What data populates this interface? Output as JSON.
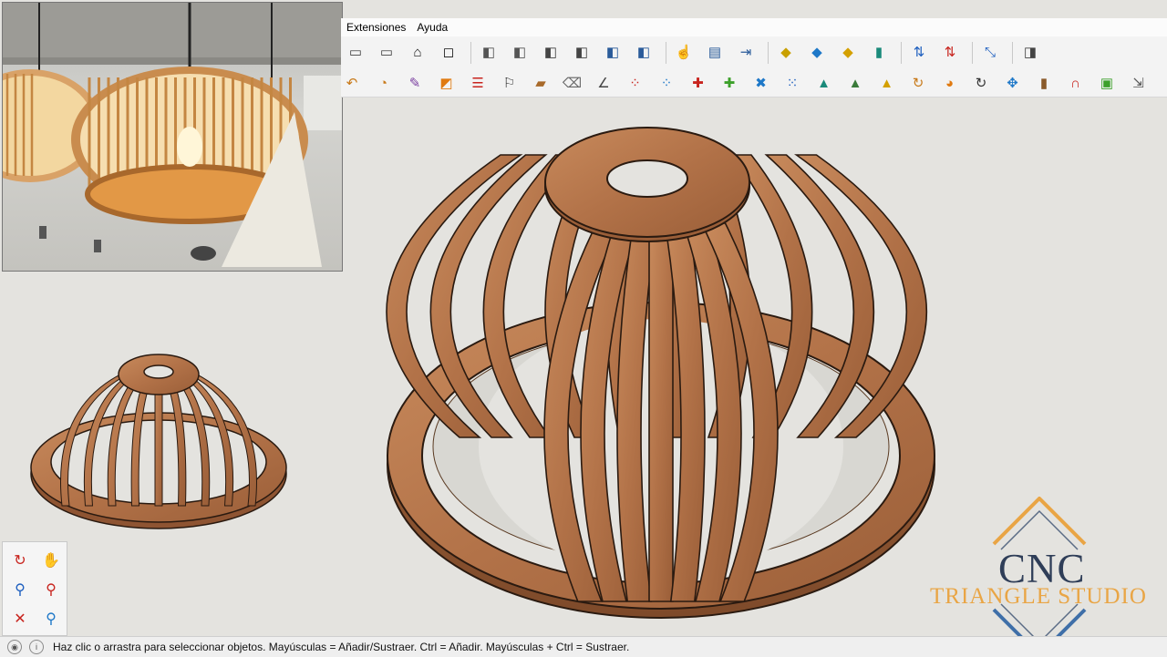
{
  "menu": {
    "extensions": "Extensiones",
    "help": "Ayuda"
  },
  "status": {
    "message": "Haz clic o arrastra para seleccionar objetos. Mayúsculas = Añadir/Sustraer. Ctrl = Añadir. Mayúsculas + Ctrl = Sustraer."
  },
  "logo": {
    "title": "CNC",
    "subtitle": "TRIANGLE STUDIO"
  },
  "toolbar_row1": [
    {
      "icon": "warehouse-icon",
      "glyph": "▭",
      "color": "#444"
    },
    {
      "icon": "warehouse-open-icon",
      "glyph": "▭",
      "color": "#444"
    },
    {
      "icon": "home-icon",
      "glyph": "⌂",
      "color": "#111"
    },
    {
      "icon": "square-icon",
      "glyph": "◻",
      "color": "#111"
    },
    {
      "icon": "view-iso-icon",
      "glyph": "◧",
      "color": "#555"
    },
    {
      "icon": "view-top-icon",
      "glyph": "◧",
      "color": "#555"
    },
    {
      "icon": "view-front-icon",
      "glyph": "◧",
      "color": "#444"
    },
    {
      "icon": "view-right-icon",
      "glyph": "◧",
      "color": "#444"
    },
    {
      "icon": "view-back-icon",
      "glyph": "◧",
      "color": "#2a5b9a"
    },
    {
      "icon": "view-left-icon",
      "glyph": "◧",
      "color": "#2a5b9a"
    },
    {
      "icon": "hand-pointer-icon",
      "glyph": "☝",
      "color": "#333"
    },
    {
      "icon": "report-icon",
      "glyph": "▤",
      "color": "#2a5b9a"
    },
    {
      "icon": "arrow-box-icon",
      "glyph": "⇥",
      "color": "#2a5b9a"
    },
    {
      "icon": "component-icon",
      "glyph": "◆",
      "color": "#c9a000"
    },
    {
      "icon": "tag-blue-icon",
      "glyph": "◆",
      "color": "#1e78c8"
    },
    {
      "icon": "tag-yellow-icon",
      "glyph": "◆",
      "color": "#d4a000"
    },
    {
      "icon": "cube-icon",
      "glyph": "▮",
      "color": "#1a8a7a"
    },
    {
      "icon": "arrows-updown-icon",
      "glyph": "⇅",
      "color": "#1e5fbf"
    },
    {
      "icon": "arrows-red-icon",
      "glyph": "⇅",
      "color": "#c8241e"
    },
    {
      "icon": "resize-icon",
      "glyph": "⤡",
      "color": "#1e5fbf"
    },
    {
      "icon": "extra-icon",
      "glyph": "◨",
      "color": "#444"
    }
  ],
  "toolbar_row2": [
    {
      "icon": "orbit-undo-icon",
      "glyph": "↶",
      "color": "#c87a1a"
    },
    {
      "icon": "swirl-icon",
      "glyph": "◔",
      "color": "#c87a1a"
    },
    {
      "icon": "paint-icon",
      "glyph": "✎",
      "color": "#7a3fa0"
    },
    {
      "icon": "square-orange-icon",
      "glyph": "◩",
      "color": "#e07a10"
    },
    {
      "icon": "list-icon",
      "glyph": "☰",
      "color": "#c8241e"
    },
    {
      "icon": "flag-icon",
      "glyph": "⚐",
      "color": "#333"
    },
    {
      "icon": "box-icon",
      "glyph": "▰",
      "color": "#a86a2a"
    },
    {
      "icon": "eraser-icon",
      "glyph": "⌫",
      "color": "#666"
    },
    {
      "icon": "angle-icon",
      "glyph": "∠",
      "color": "#444"
    },
    {
      "icon": "dots-red-icon",
      "glyph": "⁘",
      "color": "#c8241e"
    },
    {
      "icon": "dots-blue-icon",
      "glyph": "⁘",
      "color": "#1e78c8"
    },
    {
      "icon": "plus-red-icon",
      "glyph": "✚",
      "color": "#c8241e"
    },
    {
      "icon": "plus-green-icon",
      "glyph": "✚",
      "color": "#3ca02a"
    },
    {
      "icon": "cross-blue-icon",
      "glyph": "✖",
      "color": "#1e78c8"
    },
    {
      "icon": "grid-icon",
      "glyph": "⁙",
      "color": "#1e5fbf"
    },
    {
      "icon": "flask-icon",
      "glyph": "▲",
      "color": "#1a8a7a"
    },
    {
      "icon": "mountain-icon",
      "glyph": "▲",
      "color": "#3a7a3a"
    },
    {
      "icon": "pyramid-icon",
      "glyph": "▲",
      "color": "#d4a000"
    },
    {
      "icon": "rotate-icon",
      "glyph": "↻",
      "color": "#c87a1a"
    },
    {
      "icon": "orange-shape-icon",
      "glyph": "◕",
      "color": "#e07a10"
    },
    {
      "icon": "rotate-dark-icon",
      "glyph": "↻",
      "color": "#333"
    },
    {
      "icon": "move-icon",
      "glyph": "✥",
      "color": "#1e78c8"
    },
    {
      "icon": "barrel-icon",
      "glyph": "▮",
      "color": "#8a5a2a"
    },
    {
      "icon": "magnet-icon",
      "glyph": "∩",
      "color": "#c8241e"
    },
    {
      "icon": "group-green-icon",
      "glyph": "▣",
      "color": "#3ca02a"
    },
    {
      "icon": "export-icon",
      "glyph": "⇲",
      "color": "#555"
    }
  ],
  "nav_tools": [
    {
      "icon": "orbit-icon",
      "glyph": "↻",
      "color": "#c8241e"
    },
    {
      "icon": "pan-hand-icon",
      "glyph": "✋",
      "color": "#c89a3a"
    },
    {
      "icon": "zoom-icon",
      "glyph": "⚲",
      "color": "#1e5fbf"
    },
    {
      "icon": "zoom-window-icon",
      "glyph": "⚲",
      "color": "#c8241e"
    },
    {
      "icon": "zoom-extents-icon",
      "glyph": "✕",
      "color": "#c8241e"
    },
    {
      "icon": "previous-view-icon",
      "glyph": "⚲",
      "color": "#1e78c8"
    }
  ],
  "colors": {
    "wood": "#b27248",
    "wood_dark": "#8e5432",
    "wood_light": "#c88a5c",
    "outline": "#2a1a10",
    "canvas": "#e4e3df"
  }
}
